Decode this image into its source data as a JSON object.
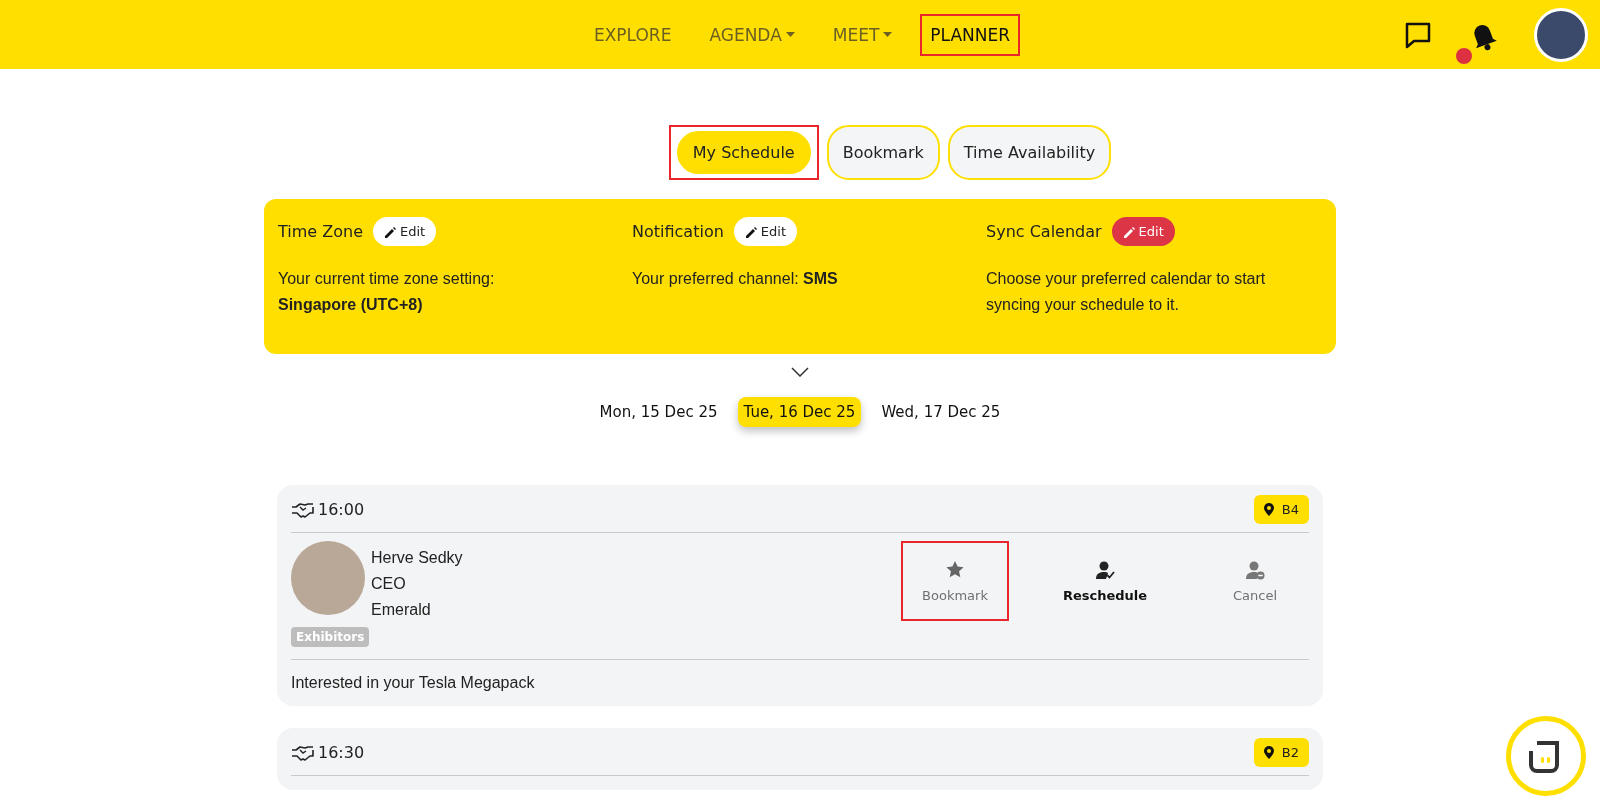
{
  "nav": {
    "items": [
      {
        "label": "EXPLORE",
        "dropdown": false,
        "selected": false,
        "highlighted": false
      },
      {
        "label": "AGENDA",
        "dropdown": true,
        "selected": false,
        "highlighted": false
      },
      {
        "label": "MEET",
        "dropdown": true,
        "selected": false,
        "highlighted": false
      },
      {
        "label": "PLANNER",
        "dropdown": false,
        "selected": true,
        "highlighted": true
      }
    ],
    "notification_dot": true
  },
  "tabs": [
    {
      "label": "My Schedule",
      "selected": true,
      "highlighted": true
    },
    {
      "label": "Bookmark",
      "selected": false,
      "highlighted": false
    },
    {
      "label": "Time Availability",
      "selected": false,
      "highlighted": false
    }
  ],
  "settings": [
    {
      "title": "Time Zone",
      "edit": {
        "label": "Edit",
        "kind": "light"
      },
      "text": "Your current time zone setting: **Singapore (UTC+8)**"
    },
    {
      "title": "Notification",
      "edit": {
        "label": "Edit",
        "kind": "light"
      },
      "text": "Your preferred channel: **SMS**"
    },
    {
      "title": "Sync Calendar",
      "edit": {
        "label": "Edit",
        "kind": "danger"
      },
      "text": "Choose your preferred calendar to start syncing your schedule to it."
    }
  ],
  "dates": [
    {
      "label": "Mon, 15 Dec 25",
      "selected": false
    },
    {
      "label": "Tue, 16 Dec 25",
      "selected": true
    },
    {
      "label": "Wed, 17 Dec 25",
      "selected": false
    }
  ],
  "meetings": [
    {
      "time": "16:00",
      "location": "B4",
      "person": {
        "name": "Herve Sedky",
        "title": "CEO",
        "company": "Emerald"
      },
      "tag": "Exhibitors",
      "actions": [
        {
          "label": "Bookmark",
          "kind": "star",
          "active": false,
          "highlighted": true
        },
        {
          "label": "Reschedule",
          "kind": "reschedule",
          "active": true,
          "highlighted": false
        },
        {
          "label": "Cancel",
          "kind": "cancel",
          "active": false,
          "highlighted": false
        }
      ],
      "note": "Interested in your Tesla Megapack"
    },
    {
      "time": "16:30",
      "location": "B2"
    }
  ]
}
